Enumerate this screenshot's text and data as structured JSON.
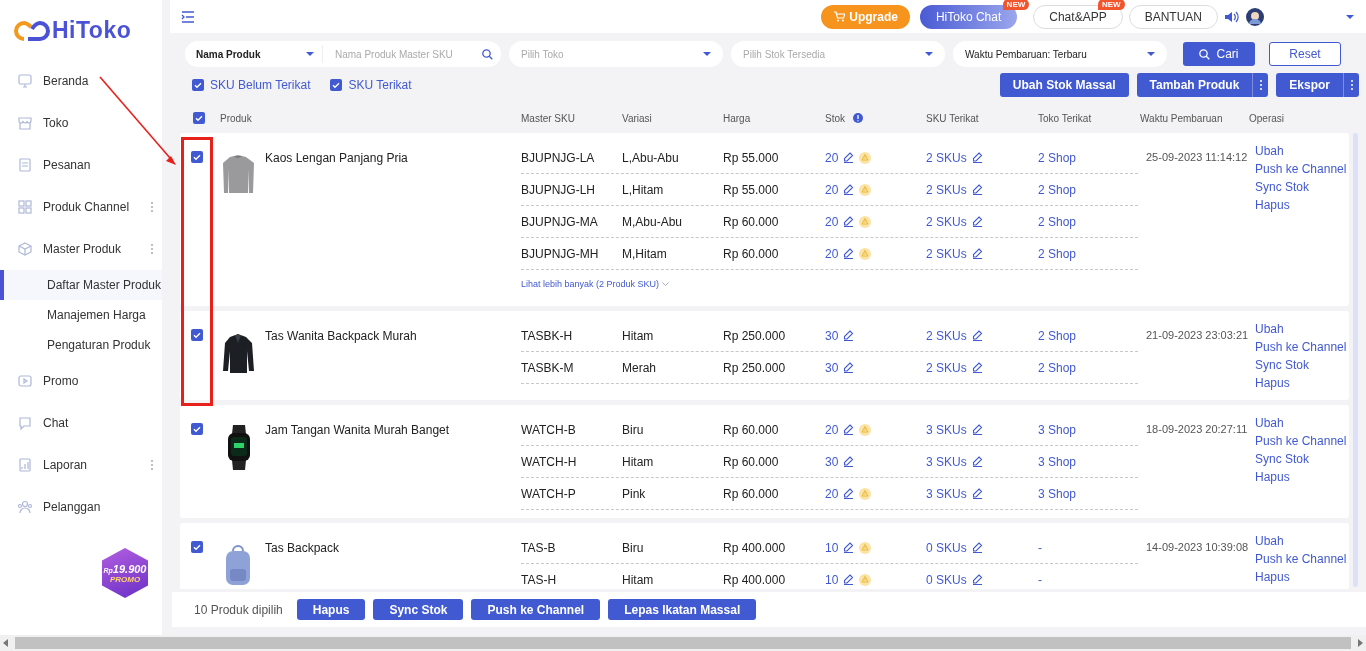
{
  "sidebar": {
    "logo": "HiToko",
    "items": [
      {
        "label": "Beranda",
        "has_submenu": false
      },
      {
        "label": "Toko",
        "has_submenu": false
      },
      {
        "label": "Pesanan",
        "has_submenu": false
      },
      {
        "label": "Produk Channel",
        "has_submenu": true
      },
      {
        "label": "Master Produk",
        "has_submenu": true,
        "children": [
          {
            "label": "Daftar Master Produk",
            "selected": true
          },
          {
            "label": "Manajemen Harga",
            "selected": false
          },
          {
            "label": "Pengaturan Produk",
            "selected": false
          }
        ]
      },
      {
        "label": "Promo",
        "has_submenu": false
      },
      {
        "label": "Chat",
        "has_submenu": false
      },
      {
        "label": "Laporan",
        "has_submenu": true
      },
      {
        "label": "Pelanggan",
        "has_submenu": false
      }
    ],
    "promo": {
      "prefix": "Rp",
      "price": "19.900",
      "label": "PROMO"
    }
  },
  "topbar": {
    "buttons": [
      {
        "label": "Upgrade",
        "kind": "upgrade"
      },
      {
        "label": "HiToko Chat",
        "kind": "primary",
        "badge": "NEW"
      },
      {
        "label": "Chat&APP",
        "kind": "outline",
        "badge": "NEW"
      },
      {
        "label": "BANTUAN",
        "kind": "outline"
      }
    ]
  },
  "filters": {
    "field_type": "Nama Produk",
    "search": {
      "placeholder": "Nama Produk Master SKU"
    },
    "store": {
      "placeholder": "Pilih Toko"
    },
    "stock": {
      "placeholder": "Pilih Stok Tersedia"
    },
    "sort": "Waktu Pembaruan: Terbaru",
    "search_button": "Cari",
    "reset_button": "Reset"
  },
  "options": [
    {
      "label": "SKU Belum Terikat",
      "checked": true
    },
    {
      "label": "SKU Terikat",
      "checked": true
    }
  ],
  "actions": [
    {
      "label": "Ubah Stok Massal",
      "has_more": false
    },
    {
      "label": "Tambah Produk",
      "has_more": true
    },
    {
      "label": "Ekspor",
      "has_more": true
    }
  ],
  "table": {
    "all_checked": true,
    "columns": [
      {
        "label": "Produk"
      },
      {
        "label": "Master SKU"
      },
      {
        "label": "Variasi"
      },
      {
        "label": "Harga"
      },
      {
        "label": "Stok",
        "info": true
      },
      {
        "label": "SKU Terikat"
      },
      {
        "label": "Toko Terikat"
      },
      {
        "label": "Waktu Pembaruan"
      },
      {
        "label": "Operasi"
      }
    ],
    "products": [
      {
        "checked": true,
        "name": "Kaos Lengan Panjang Pria",
        "updated": "25-09-2023 11:14:12",
        "more_link": "Lihat lebih banyak (2 Produk SKU)",
        "operations": [
          "Ubah",
          "Push ke Channel",
          "Sync Stok",
          "Hapus"
        ],
        "variants": [
          {
            "sku": "BJUPNJG-LA",
            "variation": "L,Abu-Abu",
            "price": "Rp 55.000",
            "stock": "20",
            "warning": true,
            "linked_skus": "2 SKUs",
            "shops": "2 Shop"
          },
          {
            "sku": "BJUPNJG-LH",
            "variation": "L,Hitam",
            "price": "Rp 55.000",
            "stock": "20",
            "warning": true,
            "linked_skus": "2 SKUs",
            "shops": "2 Shop"
          },
          {
            "sku": "BJUPNJG-MA",
            "variation": "M,Abu-Abu",
            "price": "Rp 60.000",
            "stock": "20",
            "warning": true,
            "linked_skus": "2 SKUs",
            "shops": "2 Shop"
          },
          {
            "sku": "BJUPNJG-MH",
            "variation": "M,Hitam",
            "price": "Rp 60.000",
            "stock": "20",
            "warning": true,
            "linked_skus": "2 SKUs",
            "shops": "2 Shop"
          }
        ]
      },
      {
        "checked": true,
        "name": "Tas Wanita Backpack Murah",
        "updated": "21-09-2023 23:03:21",
        "operations": [
          "Ubah",
          "Push ke Channel",
          "Sync Stok",
          "Hapus"
        ],
        "variants": [
          {
            "sku": "TASBK-H",
            "variation": "Hitam",
            "price": "Rp 250.000",
            "stock": "30",
            "warning": false,
            "linked_skus": "2 SKUs",
            "shops": "2 Shop"
          },
          {
            "sku": "TASBK-M",
            "variation": "Merah",
            "price": "Rp 250.000",
            "stock": "30",
            "warning": false,
            "linked_skus": "2 SKUs",
            "shops": "2 Shop"
          }
        ]
      },
      {
        "checked": true,
        "name": "Jam Tangan Wanita Murah Banget",
        "updated": "18-09-2023 20:27:11",
        "operations": [
          "Ubah",
          "Push ke Channel",
          "Sync Stok",
          "Hapus"
        ],
        "variants": [
          {
            "sku": "WATCH-B",
            "variation": "Biru",
            "price": "Rp 60.000",
            "stock": "20",
            "warning": true,
            "linked_skus": "3 SKUs",
            "shops": "3 Shop"
          },
          {
            "sku": "WATCH-H",
            "variation": "Hitam",
            "price": "Rp 60.000",
            "stock": "30",
            "warning": false,
            "linked_skus": "3 SKUs",
            "shops": "3 Shop"
          },
          {
            "sku": "WATCH-P",
            "variation": "Pink",
            "price": "Rp 60.000",
            "stock": "20",
            "warning": true,
            "linked_skus": "3 SKUs",
            "shops": "3 Shop"
          }
        ]
      },
      {
        "checked": true,
        "name": "Tas Backpack",
        "updated": "14-09-2023 10:39:08",
        "operations": [
          "Ubah",
          "Push ke Channel",
          "Hapus"
        ],
        "variants": [
          {
            "sku": "TAS-B",
            "variation": "Biru",
            "price": "Rp 400.000",
            "stock": "10",
            "warning": true,
            "linked_skus": "0 SKUs",
            "shops": "-"
          },
          {
            "sku": "TAS-H",
            "variation": "Hitam",
            "price": "Rp 400.000",
            "stock": "10",
            "warning": true,
            "linked_skus": "0 SKUs",
            "shops": "-"
          }
        ]
      }
    ]
  },
  "selection_bar": {
    "count_text": "10 Produk dipilih",
    "buttons": [
      "Hapus",
      "Sync Stok",
      "Push ke Channel",
      "Lepas Ikatan Massal"
    ]
  }
}
